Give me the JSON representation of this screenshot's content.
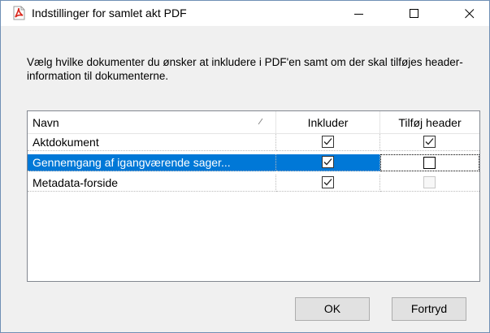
{
  "window": {
    "title": "Indstillinger for samlet akt PDF",
    "icon": "pdf-icon",
    "controls": [
      "minimize-icon",
      "maximize-icon",
      "close-icon"
    ]
  },
  "description": "Vælg hvilke dokumenter du ønsker at inkludere i PDF'en samt om der skal tilføjes header-information til dokumenterne.",
  "table": {
    "columns": [
      "Navn",
      "Inkluder",
      "Tilføj header"
    ],
    "rows": [
      {
        "name": "Aktdokument",
        "include": true,
        "header": true,
        "header_enabled": true,
        "selected": false
      },
      {
        "name": "Gennemgang af igangværende sager...",
        "include": true,
        "header": false,
        "header_enabled": true,
        "selected": true
      },
      {
        "name": "Metadata-forside",
        "include": true,
        "header": false,
        "header_enabled": false,
        "selected": false
      }
    ]
  },
  "buttons": {
    "ok": "OK",
    "cancel": "Fortryd"
  },
  "colors": {
    "selection": "#0078d7",
    "pdf_icon": "#d9261c"
  }
}
